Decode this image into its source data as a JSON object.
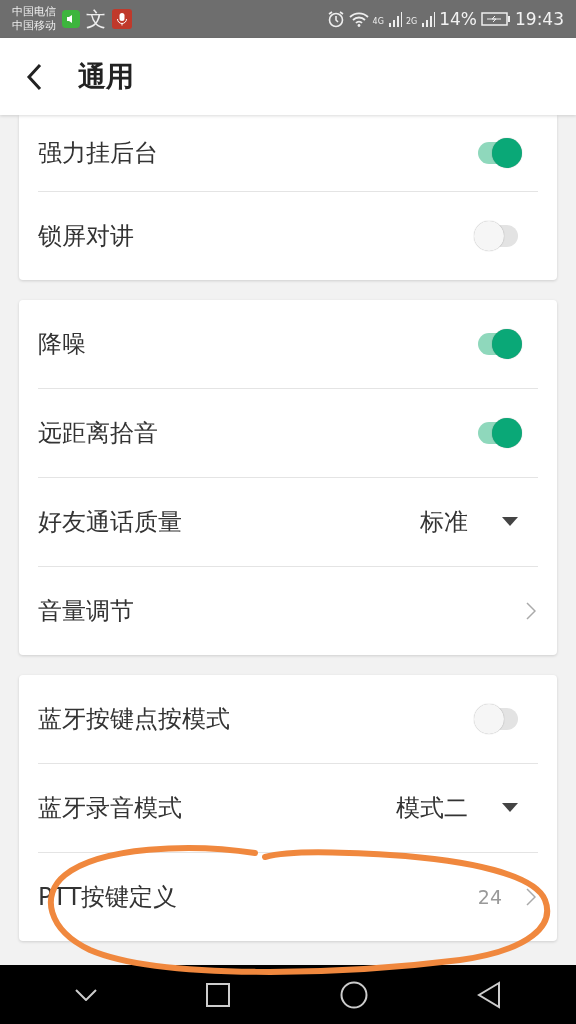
{
  "status_bar": {
    "carriers": [
      "中国电信",
      "中国移动"
    ],
    "ime_glyph": "文",
    "network_1": "4G",
    "network_2": "2G",
    "battery": "14%",
    "time": "19:43"
  },
  "header": {
    "title": "通用"
  },
  "groups": [
    {
      "rows": [
        {
          "kind": "toggle",
          "label": "强力挂后台",
          "on": true
        },
        {
          "kind": "toggle",
          "label": "锁屏对讲",
          "on": false
        }
      ]
    },
    {
      "rows": [
        {
          "kind": "toggle",
          "label": "降噪",
          "on": true
        },
        {
          "kind": "toggle",
          "label": "远距离拾音",
          "on": true
        },
        {
          "kind": "select",
          "label": "好友通话质量",
          "value": "标准"
        },
        {
          "kind": "link",
          "label": "音量调节"
        }
      ]
    },
    {
      "rows": [
        {
          "kind": "toggle",
          "label": "蓝牙按键点按模式",
          "on": false
        },
        {
          "kind": "select",
          "label": "蓝牙录音模式",
          "value": "模式二"
        },
        {
          "kind": "link",
          "label": "PTT按键定义",
          "value": "24"
        }
      ]
    }
  ],
  "annotations": [
    {
      "kind": "freehand-circle"
    }
  ]
}
